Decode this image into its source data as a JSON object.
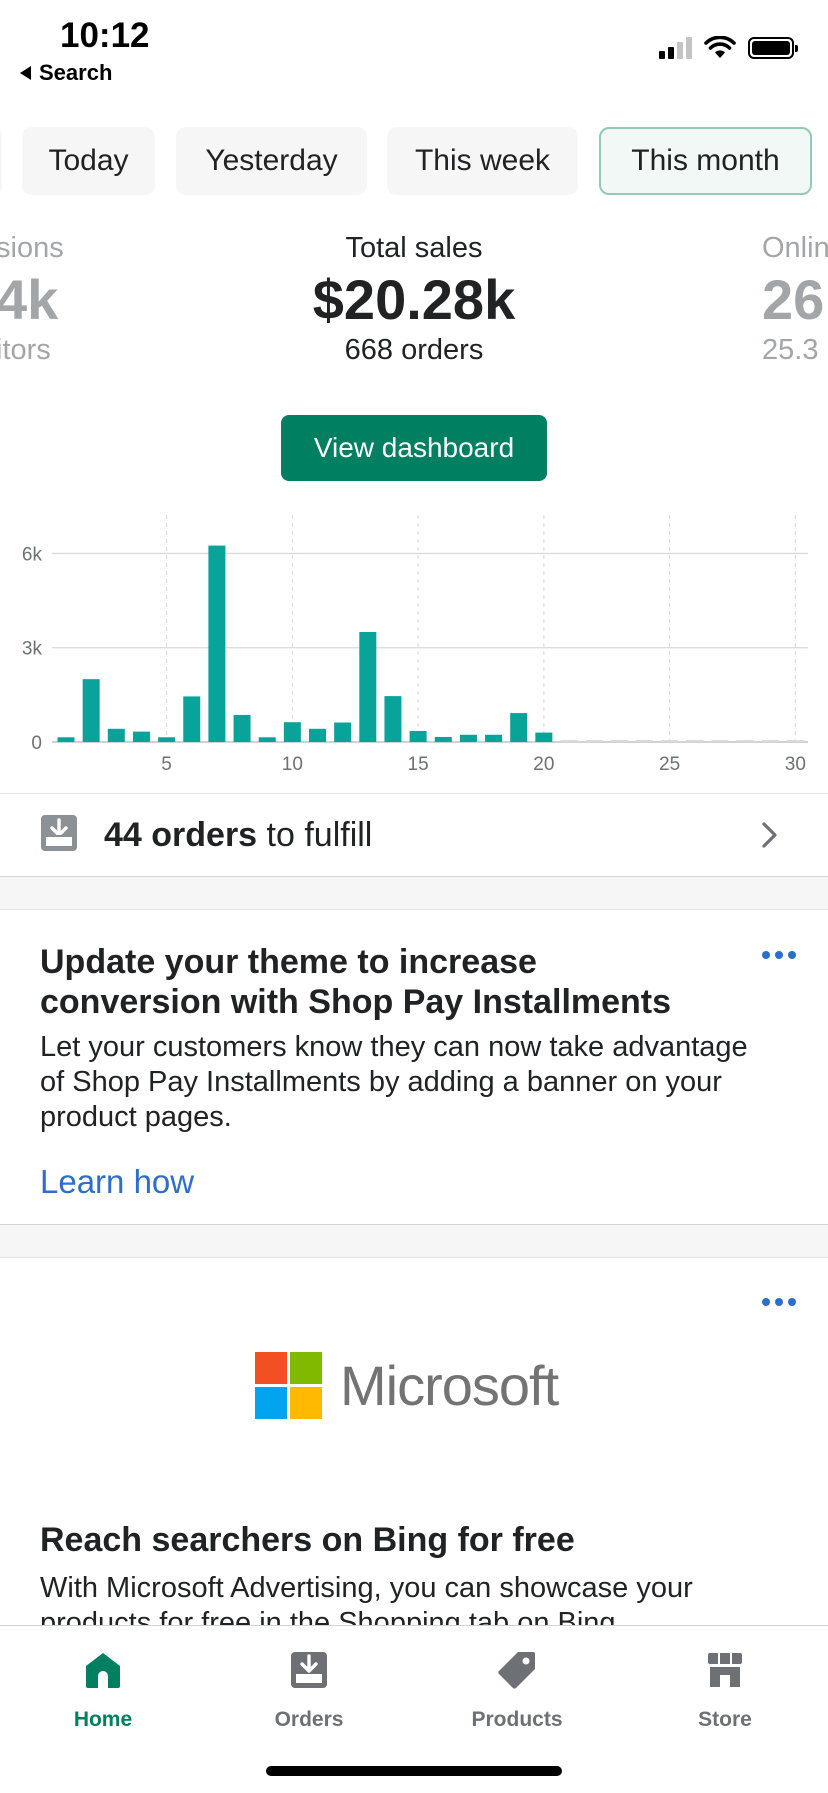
{
  "status_bar": {
    "time": "10:12",
    "back_label": "Search"
  },
  "date_tabs": [
    {
      "label": "Today",
      "active": false
    },
    {
      "label": "Yesterday",
      "active": false
    },
    {
      "label": "This week",
      "active": false
    },
    {
      "label": "This month",
      "active": true
    }
  ],
  "metrics": {
    "left": {
      "label": "sions",
      "value": "4k",
      "sub": "itors"
    },
    "center": {
      "label": "Total sales",
      "value": "$20.28k",
      "sub": "668 orders"
    },
    "right": {
      "label": "Onlin",
      "value": "26",
      "sub": "25.3"
    }
  },
  "view_dashboard_label": "View dashboard",
  "chart_data": {
    "type": "bar",
    "x": [
      1,
      2,
      3,
      4,
      5,
      6,
      7,
      8,
      9,
      10,
      11,
      12,
      13,
      14,
      15,
      16,
      17,
      18,
      19,
      20,
      21,
      22,
      23,
      24,
      25,
      26,
      27,
      28,
      29,
      30
    ],
    "values": [
      150,
      2000,
      420,
      330,
      150,
      1450,
      6250,
      860,
      150,
      630,
      420,
      620,
      3500,
      1460,
      350,
      160,
      230,
      230,
      920,
      300,
      0,
      0,
      0,
      0,
      0,
      0,
      0,
      0,
      0,
      0
    ],
    "x_ticks": [
      "5",
      "10",
      "15",
      "20",
      "25",
      "30"
    ],
    "y_ticks": [
      "0",
      "3k",
      "6k"
    ],
    "ylim": [
      0,
      7000
    ],
    "color": "#0aa39a"
  },
  "fulfill": {
    "count_text": "44 orders",
    "rest_text": " to fulfill"
  },
  "shop_pay_card": {
    "title_line1": "Update your theme to increase",
    "title_line2": "conversion with Shop Pay Installments",
    "body": "Let your customers know they can now take advantage of Shop Pay Installments by adding a banner on your product pages.",
    "link": "Learn how"
  },
  "bing_card": {
    "logo_text": "Microsoft",
    "title": "Reach searchers on Bing for free",
    "body": "With Microsoft Advertising, you can showcase your products for free in the Shopping tab on Bing."
  },
  "tab_bar": [
    {
      "label": "Home",
      "icon": "home-icon",
      "active": true
    },
    {
      "label": "Orders",
      "icon": "orders-icon",
      "active": false
    },
    {
      "label": "Products",
      "icon": "tag-icon",
      "active": false
    },
    {
      "label": "Store",
      "icon": "store-icon",
      "active": false
    }
  ],
  "colors": {
    "primary": "#008060",
    "link": "#2c6ecb",
    "chart": "#0aa39a"
  }
}
